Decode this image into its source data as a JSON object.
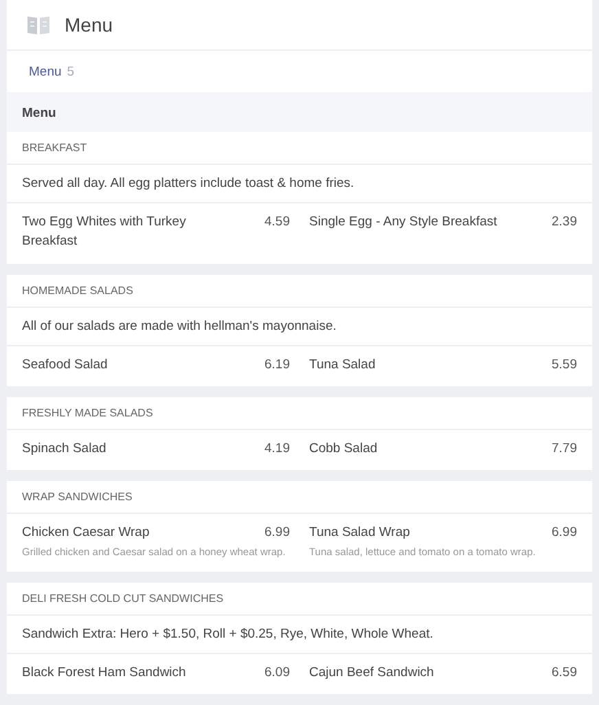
{
  "header": {
    "title": "Menu"
  },
  "breadcrumb": {
    "link": "Menu",
    "count": "5"
  },
  "menu_heading": "Menu",
  "sections": [
    {
      "title": "BREAKFAST",
      "note": "Served all day. All egg platters include toast & home fries.",
      "items": [
        {
          "name": "Two Egg Whites with Turkey Breakfast",
          "price": "4.59"
        },
        {
          "name": "Single Egg - Any Style Breakfast",
          "price": "2.39"
        }
      ]
    },
    {
      "title": "HOMEMADE SALADS",
      "note": "All of our salads are made with hellman's mayonnaise.",
      "items": [
        {
          "name": "Seafood Salad",
          "price": "6.19"
        },
        {
          "name": "Tuna Salad",
          "price": "5.59"
        }
      ]
    },
    {
      "title": "FRESHLY MADE SALADS",
      "items": [
        {
          "name": "Spinach Salad",
          "price": "4.19"
        },
        {
          "name": "Cobb Salad",
          "price": "7.79"
        }
      ]
    },
    {
      "title": "WRAP SANDWICHES",
      "items": [
        {
          "name": "Chicken Caesar Wrap",
          "price": "6.99",
          "description": "Grilled chicken and Caesar salad on a honey wheat wrap."
        },
        {
          "name": "Tuna Salad Wrap",
          "price": "6.99",
          "description": "Tuna salad, lettuce and tomato on a tomato wrap."
        }
      ]
    },
    {
      "title": "DELI FRESH COLD CUT SANDWICHES",
      "note": "Sandwich Extra: Hero + $1.50, Roll + $0.25, Rye, White, Whole Wheat.",
      "items": [
        {
          "name": "Black Forest Ham Sandwich",
          "price": "6.09"
        },
        {
          "name": "Cajun Beef Sandwich",
          "price": "6.59"
        }
      ]
    }
  ]
}
